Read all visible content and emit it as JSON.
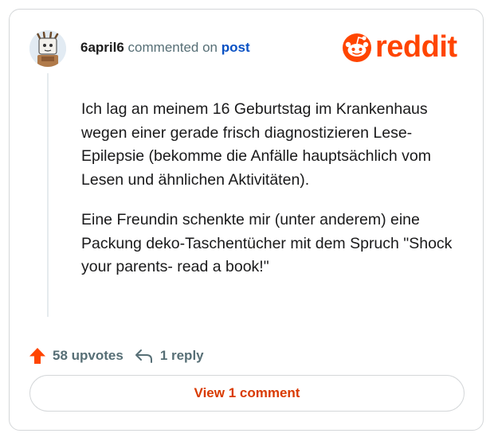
{
  "comment": {
    "username": "6april6",
    "commented_on_text": "commented on",
    "post_link_label": "post",
    "body_paragraphs": [
      "Ich lag an meinem 16 Geburtstag im Krankenhaus wegen einer gerade frisch diagnostizieren Lese-Epilepsie (bekomme die Anfälle hauptsächlich vom Lesen und ähnlichen Aktivitäten).",
      "Eine Freundin schenkte mir (unter anderem) eine Packung deko-Taschentücher mit dem Spruch \"Shock your parents- read a book!\""
    ]
  },
  "brand": {
    "wordmark": "reddit",
    "color": "#ff4500"
  },
  "actions": {
    "upvotes_label": "58 upvotes",
    "replies_label": "1 reply",
    "view_comments_label": "View 1 comment",
    "upvote_color": "#ff4500",
    "link_color": "#d93a00"
  },
  "icons": {
    "avatar": "snoo-avatar",
    "upvote": "arrow-up-icon",
    "reply": "reply-arrow-icon",
    "logo": "reddit-snoo-icon"
  }
}
